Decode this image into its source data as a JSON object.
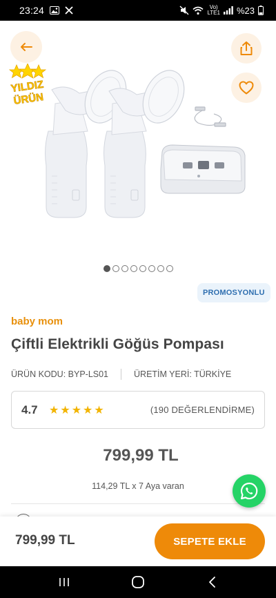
{
  "status_bar": {
    "time": "23:24",
    "network": "LTE1",
    "battery_percent": "%23"
  },
  "gallery": {
    "badge_line1": "YILDIZ",
    "badge_line2": "ÜRÜN",
    "image_count": 8,
    "active_index": 0
  },
  "product": {
    "promo_label": "PROMOSYONLU",
    "brand": "baby mom",
    "title": "Çiftli Elektrikli Göğüs Pompası",
    "code_label": "ÜRÜN KODU: BYP-LS01",
    "origin_label": "ÜRETİM YERİ: TÜRKİYE",
    "rating": "4.7",
    "stars": 5,
    "review_count": "(190 DEĞERLENDİRME)",
    "price": "799,99 TL",
    "installment": "114,29 TL x 7 Aya varan"
  },
  "bottom_bar": {
    "price": "799,99 TL",
    "add_to_cart_label": "SEPETE EKLE"
  },
  "colors": {
    "accent": "#ee8a09",
    "brand": "#e8900c",
    "promo_text": "#2f6fb0",
    "promo_bg": "#eaf3fb",
    "whatsapp": "#25d366",
    "star": "#f2b400"
  },
  "icons": {
    "back": "arrow-left-icon",
    "share": "share-icon",
    "favorite": "heart-icon",
    "whatsapp": "whatsapp-icon"
  }
}
